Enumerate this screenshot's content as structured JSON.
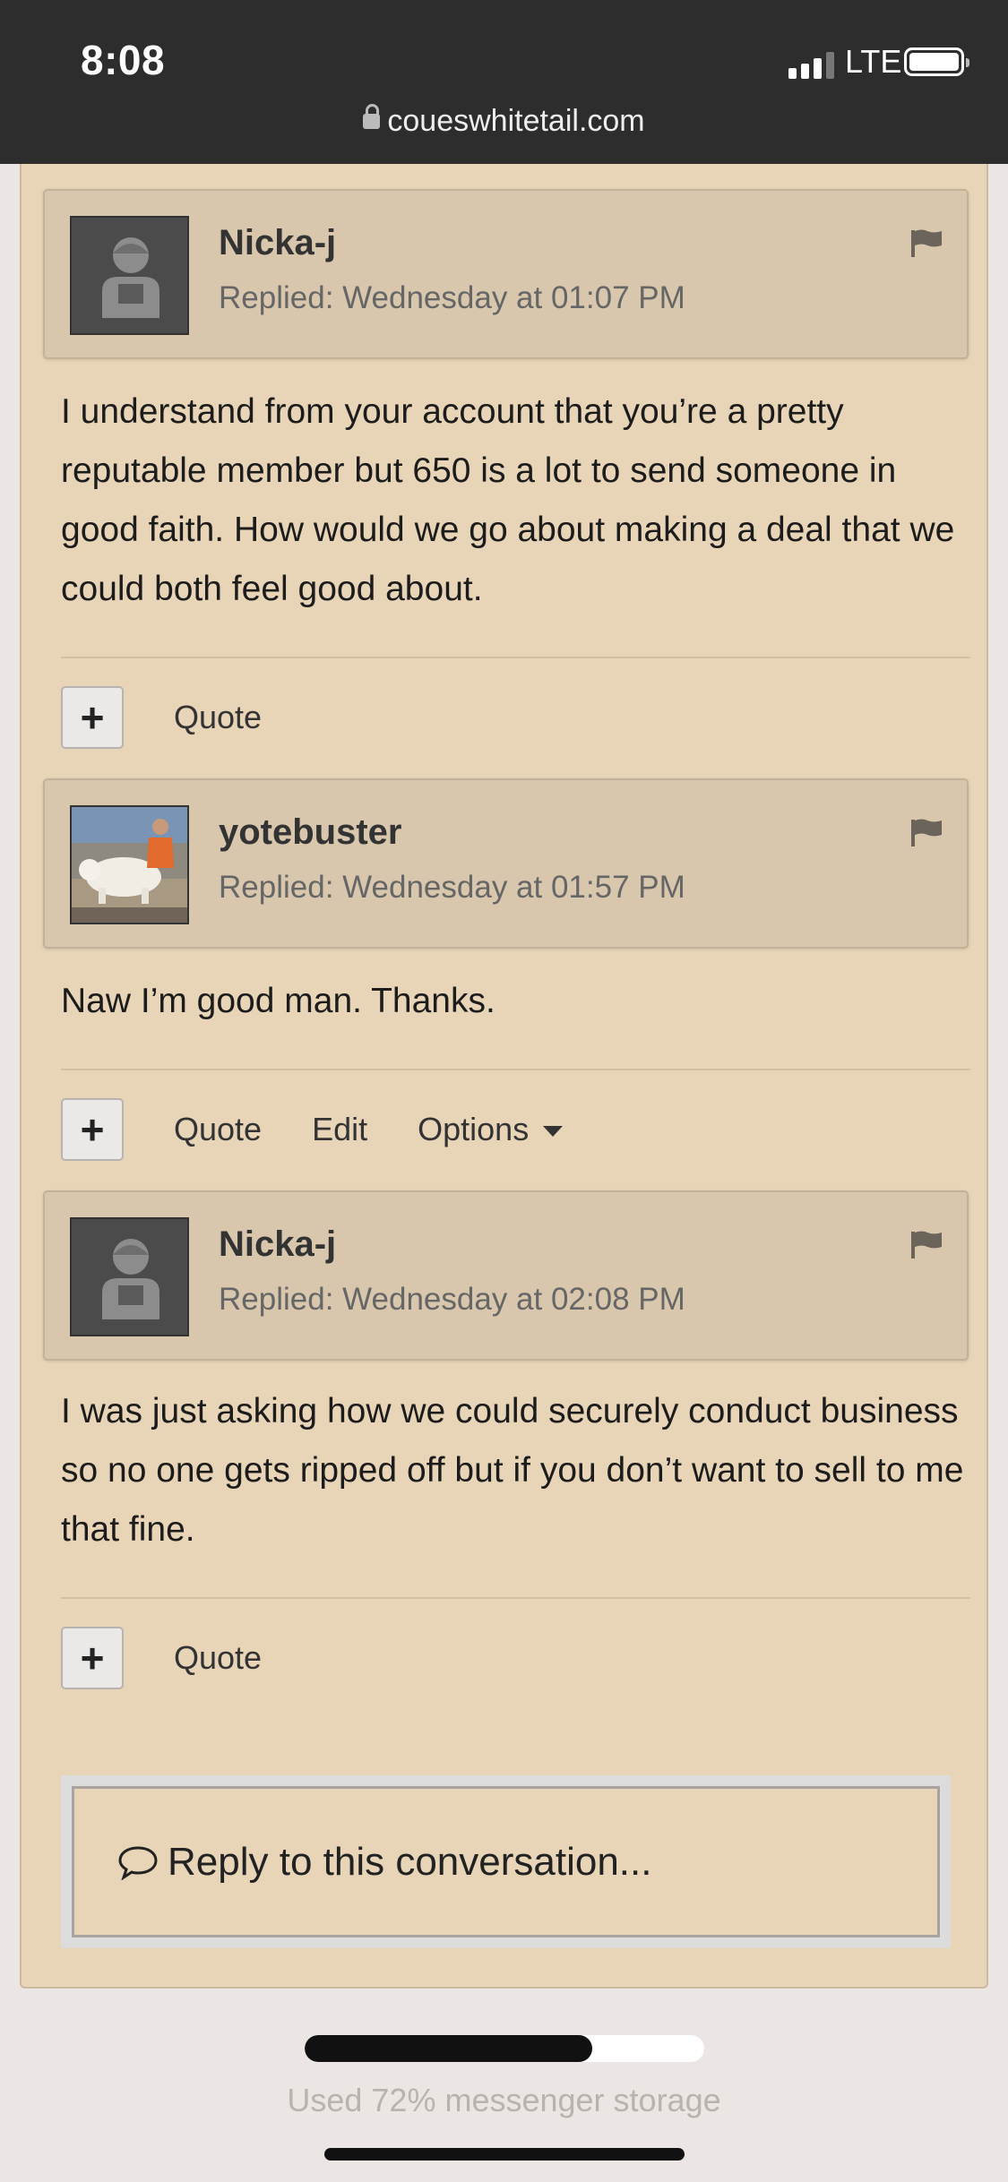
{
  "status_bar": {
    "time": "8:08",
    "network": "LTE",
    "url": "coueswhitetail.com"
  },
  "messages": [
    {
      "username": "Nicka-j",
      "replied": "Replied: Wednesday at 01:07 PM",
      "avatar": "default-avatar-icon",
      "body": "I understand from your account that you’re a pretty reputable member but 650 is a lot to send someone in good faith. How would we go about making a deal that we could both feel good about.",
      "actions": {
        "plus": "+",
        "quote": "Quote"
      }
    },
    {
      "username": "yotebuster",
      "replied": "Replied: Wednesday at 01:57 PM",
      "avatar": "user-photo-avatar",
      "body": "Naw I’m good man.  Thanks.",
      "actions": {
        "plus": "+",
        "quote": "Quote",
        "edit": "Edit",
        "options": "Options"
      }
    },
    {
      "username": "Nicka-j",
      "replied": "Replied: Wednesday at 02:08 PM",
      "avatar": "default-avatar-icon",
      "body": "I was just asking how we could securely conduct business so no one gets ripped off but if you don’t want to sell to me that fine.",
      "actions": {
        "plus": "+",
        "quote": "Quote"
      }
    }
  ],
  "reply_box": {
    "label": "Reply to this conversation..."
  },
  "storage": {
    "percent_used": 72,
    "text": "Used 72% messenger storage"
  },
  "colors": {
    "panel": "#e8d4b7",
    "header": "#d8c7ad",
    "status_bar": "#2d2d2d"
  }
}
